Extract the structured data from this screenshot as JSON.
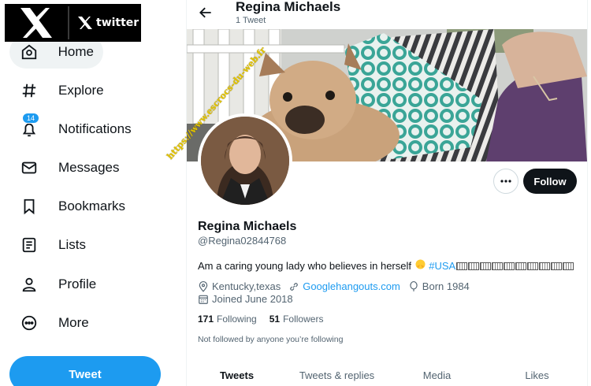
{
  "logo": {
    "brand": "twitter"
  },
  "nav": {
    "items": [
      {
        "label": "Home",
        "icon": "home-icon"
      },
      {
        "label": "Explore",
        "icon": "hashtag-icon"
      },
      {
        "label": "Notifications",
        "icon": "bell-icon",
        "badge": "14"
      },
      {
        "label": "Messages",
        "icon": "envelope-icon"
      },
      {
        "label": "Bookmarks",
        "icon": "bookmark-icon"
      },
      {
        "label": "Lists",
        "icon": "list-icon"
      },
      {
        "label": "Profile",
        "icon": "person-icon"
      },
      {
        "label": "More",
        "icon": "more-circle-icon"
      }
    ],
    "tweet_label": "Tweet"
  },
  "header": {
    "name": "Regina Michaels",
    "tweet_count": "1 Tweet"
  },
  "profile": {
    "follow_label": "Follow",
    "name": "Regina Michaels",
    "handle": "@Regina02844768",
    "bio_text": "Am a caring  young lady who believes in herself ",
    "bio_hashtag": "#USA",
    "location": "Kentucky,texas",
    "website": "Googlehangouts.com",
    "born": "Born 1984",
    "joined": "Joined June 2018",
    "following_count": "171",
    "following_label": "Following",
    "followers_count": "51",
    "followers_label": "Followers",
    "not_followed": "Not followed by anyone you’re following"
  },
  "tabs": [
    "Tweets",
    "Tweets & replies",
    "Media",
    "Likes"
  ],
  "watermark": "https://www.escrocs-du-web.fr",
  "colors": {
    "accent": "#1d9bf0",
    "text": "#0f1419",
    "muted": "#536471",
    "follow_bg": "#0f1419"
  }
}
